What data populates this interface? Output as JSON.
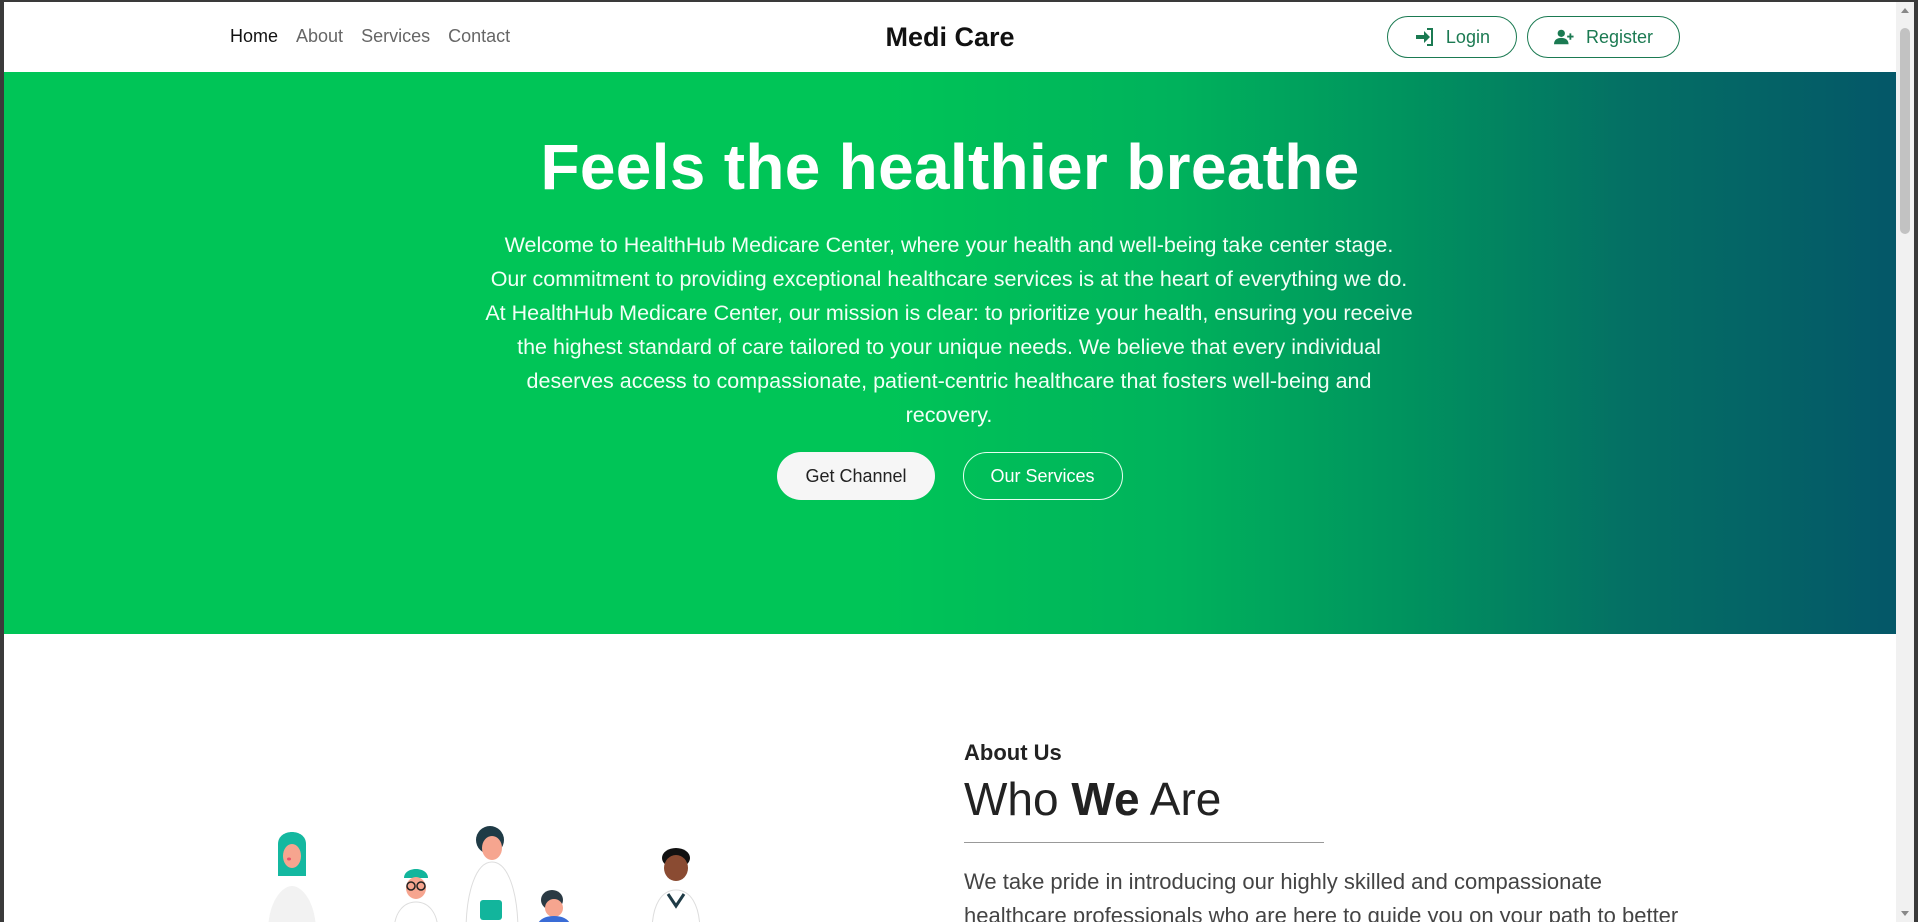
{
  "navbar": {
    "links": [
      "Home",
      "About",
      "Services",
      "Contact"
    ],
    "brand": "Medi Care",
    "login_label": "Login",
    "register_label": "Register"
  },
  "hero": {
    "title": "Feels the healthier breathe",
    "description": "Welcome to HealthHub Medicare Center, where your health and well-being take center stage. Our commitment to providing exceptional healthcare services is at the heart of everything we do. At HealthHub Medicare Center, our mission is clear: to prioritize your health, ensuring you receive the highest standard of care tailored to your unique needs. We believe that every individual deserves access to compassionate, patient-centric healthcare that fosters well-being and recovery.",
    "primary_button": "Get Channel",
    "secondary_button": "Our Services"
  },
  "about": {
    "kicker": "About Us",
    "title_start": "Who ",
    "title_bold": "We",
    "title_end": " Are",
    "body": "We take pride in introducing our highly skilled and compassionate healthcare professionals who are here to guide you on your path to better"
  },
  "colors": {
    "accent": "#1b7a52",
    "hero_green": "#00c557",
    "hero_teal": "#045768"
  }
}
